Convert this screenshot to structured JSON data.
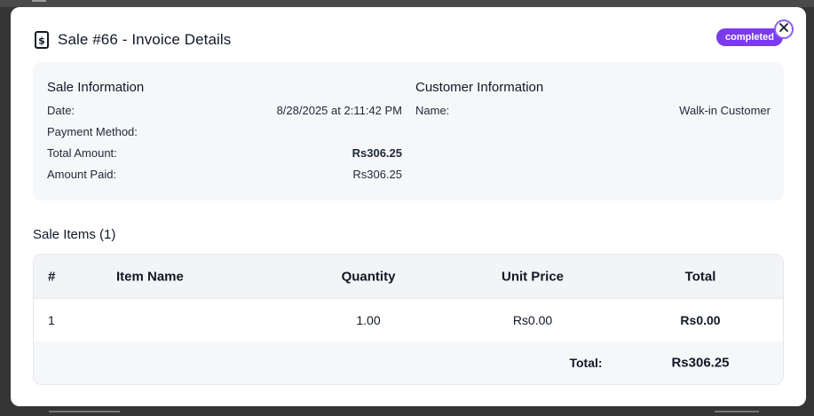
{
  "modal": {
    "title": "Sale #66 - Invoice Details",
    "status_badge": "completed"
  },
  "sale_info": {
    "heading": "Sale Information",
    "rows": [
      {
        "label": "Date:",
        "value": "8/28/2025 at 2:11:42 PM"
      },
      {
        "label": "Payment Method:",
        "value": ""
      },
      {
        "label": "Total Amount:",
        "value": "Rs306.25"
      },
      {
        "label": "Amount Paid:",
        "value": "Rs306.25"
      }
    ]
  },
  "customer_info": {
    "heading": "Customer Information",
    "rows": [
      {
        "label": "Name:",
        "value": "Walk-in Customer"
      }
    ]
  },
  "items": {
    "title": "Sale Items (1)",
    "columns": [
      "#",
      "Item Name",
      "Quantity",
      "Unit Price",
      "Total"
    ],
    "rows": [
      {
        "num": "1",
        "name": "",
        "quantity": "1.00",
        "unit_price": "Rs0.00",
        "total": "Rs0.00"
      }
    ],
    "footer_label": "Total:",
    "footer_value": "Rs306.25"
  },
  "colors": {
    "accent": "#7c3aed",
    "panel_bg": "#f6f7f9",
    "backdrop": "#353535"
  }
}
